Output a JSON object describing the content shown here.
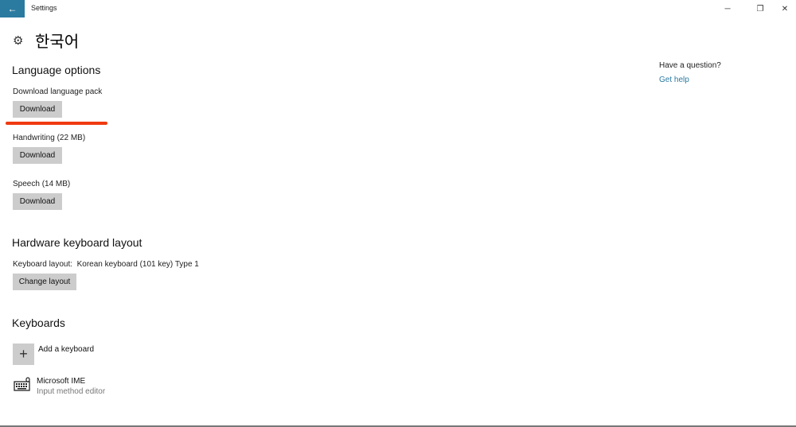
{
  "window": {
    "title": "Settings",
    "back_icon": "←",
    "minimize_icon": "─",
    "maximize_icon": "❐",
    "close_icon": "✕"
  },
  "page": {
    "title": "한국어",
    "icon": "⚙"
  },
  "language_options": {
    "heading": "Language options",
    "items": [
      {
        "label": "Download language pack",
        "button": "Download"
      },
      {
        "label": "Handwriting (22 MB)",
        "button": "Download"
      },
      {
        "label": "Speech (14 MB)",
        "button": "Download"
      }
    ]
  },
  "hardware_keyboard": {
    "heading": "Hardware keyboard layout",
    "layout_label": "Keyboard layout:",
    "layout_value": "Korean keyboard (101 key) Type 1",
    "button": "Change layout"
  },
  "keyboards": {
    "heading": "Keyboards",
    "add_icon": "+",
    "add_label": "Add a keyboard",
    "items": [
      {
        "name": "Microsoft IME",
        "subtitle": "Input method editor"
      }
    ]
  },
  "help": {
    "question": "Have a question?",
    "link": "Get help"
  },
  "annotation": {
    "color": "#f03a10"
  }
}
